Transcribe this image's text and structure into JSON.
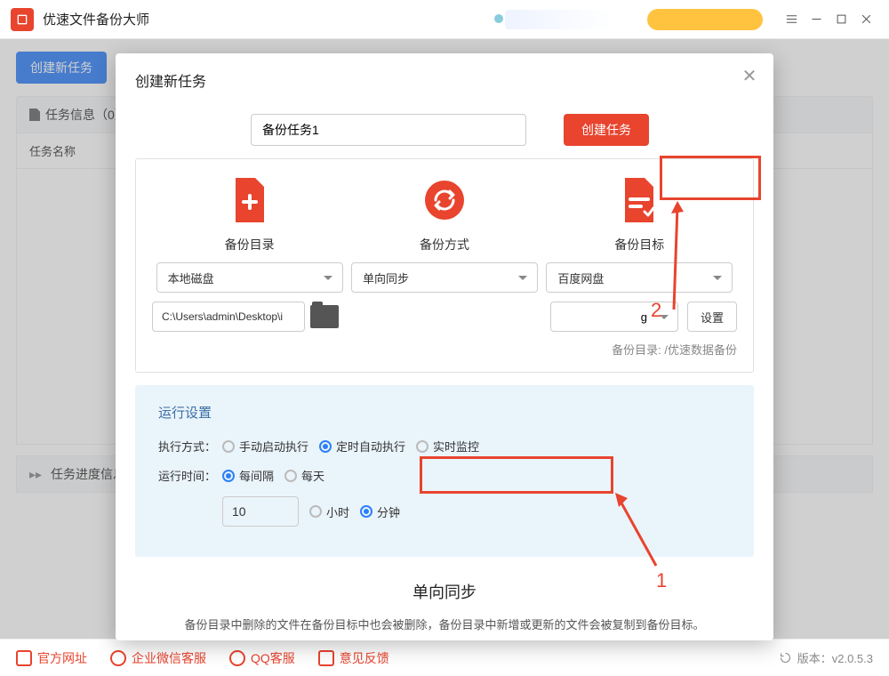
{
  "app": {
    "title": "优速文件备份大师"
  },
  "toolbar": {
    "createBtn": "创建新任务"
  },
  "taskInfo": {
    "header": "任务信息（0）",
    "colName": "任务名称"
  },
  "progress": {
    "header": "任务进度信息"
  },
  "footer": {
    "site": "官方网址",
    "wechat": "企业微信客服",
    "qq": "QQ客服",
    "feedback": "意见反馈",
    "version": "版本：v2.0.5.3"
  },
  "modal": {
    "title": "创建新任务",
    "taskName": "备份任务1",
    "createBtn": "创建任务",
    "cols": {
      "src": "备份目录",
      "mode": "备份方式",
      "dest": "备份目标"
    },
    "srcSel": "本地磁盘",
    "modeSel": "单向同步",
    "destSel": "百度网盘",
    "srcPath": "C:\\Users\\admin\\Desktop\\i",
    "destSuffix": "g",
    "setBtn": "设置",
    "note": "备份目录: /优速数据备份",
    "run": {
      "title": "运行设置",
      "execLabel": "执行方式：",
      "opts": {
        "manual": "手动启动执行",
        "timed": "定时自动执行",
        "realtime": "实时监控"
      },
      "timeLabel": "运行时间：",
      "interval": "每间隔",
      "daily": "每天",
      "num": "10",
      "hour": "小时",
      "minute": "分钟"
    },
    "syncTitle": "单向同步",
    "syncDesc": "备份目录中删除的文件在备份目标中也会被删除，备份目录中新增或更新的文件会被复制到备份目标。"
  },
  "ann": {
    "n1": "1",
    "n2": "2"
  }
}
